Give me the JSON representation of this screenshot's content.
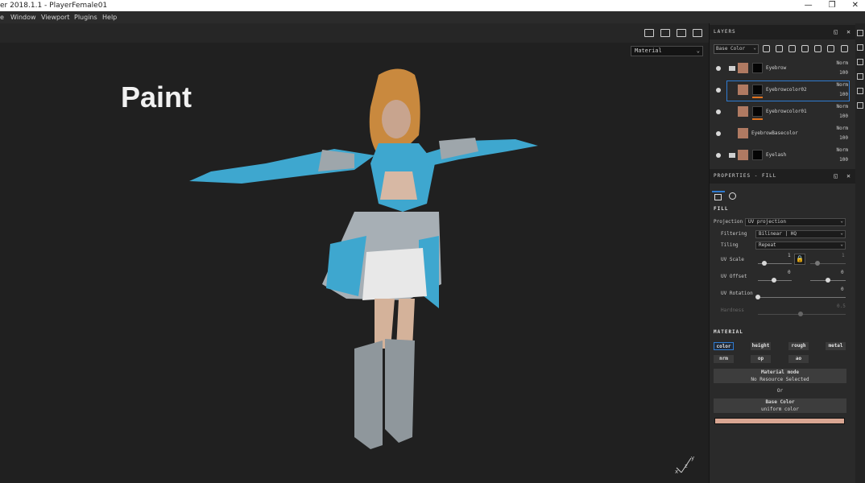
{
  "window": {
    "title": "er 2018.1.1 - PlayerFemale01",
    "minimize": "—",
    "maximize": "❐",
    "close": "✕"
  },
  "menu": [
    "e",
    "Window",
    "Viewport",
    "Plugins",
    "Help"
  ],
  "viewport": {
    "material_select": "Material",
    "overlay_text": "Paint",
    "gizmo_axes": {
      "x": "x",
      "y": "y",
      "z": "z"
    }
  },
  "layers_panel": {
    "title": "LAYERS",
    "channel_select": "Base Color",
    "layers": [
      {
        "name": "Eyebrow",
        "blend": "Norm",
        "opacity": "100",
        "folder": true,
        "mask": true,
        "selected": false
      },
      {
        "name": "Eyebrowcolor02",
        "blend": "Norm",
        "opacity": "100",
        "folder": false,
        "mask": true,
        "selected": true
      },
      {
        "name": "Eyebrowcolor01",
        "blend": "Norm",
        "opacity": "100",
        "folder": false,
        "mask": true,
        "selected": false
      },
      {
        "name": "EyebrowBasecolor",
        "blend": "Norm",
        "opacity": "100",
        "folder": false,
        "mask": false,
        "selected": false
      },
      {
        "name": "Eyelash",
        "blend": "Norm",
        "opacity": "100",
        "folder": true,
        "mask": true,
        "selected": false
      }
    ]
  },
  "properties_panel": {
    "title": "PROPERTIES - FILL",
    "fill_section": "FILL",
    "projection_label": "Projection",
    "projection_value": "UV projection",
    "filtering_label": "Filtering",
    "filtering_value": "Bilinear | HQ",
    "tiling_label": "Tiling",
    "tiling_value": "Repeat",
    "uv_scale_label": "UV Scale",
    "uv_scale_value": "1",
    "uv_scale_value2": "1",
    "uv_offset_label": "UV Offset",
    "uv_offset_x": "0",
    "uv_offset_y": "0",
    "uv_rotation_label": "UV Rotation",
    "uv_rotation_value": "0",
    "hardness_label": "Hardness",
    "hardness_value": "0.5",
    "material_section": "MATERIAL",
    "channels_row1": [
      "color",
      "height",
      "rough",
      "metal"
    ],
    "channels_row2": [
      "nrm",
      "op",
      "ao"
    ],
    "material_mode_title": "Material mode",
    "material_mode_value": "No Resource Selected",
    "or_text": "Or",
    "base_color_title": "Base Color",
    "base_color_subtitle": "uniform color",
    "base_color_hex": "#d9a692"
  }
}
